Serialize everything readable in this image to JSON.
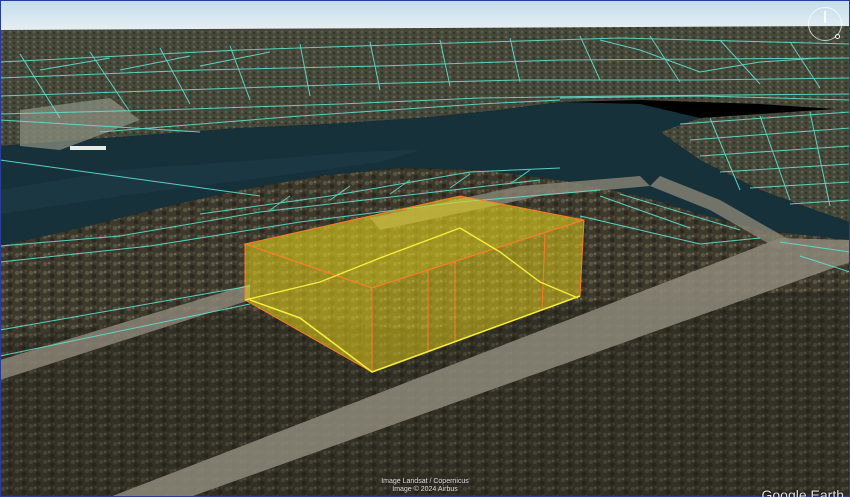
{
  "viewer": {
    "attribution_line1": "Image Landsat / Copernicus",
    "attribution_line2": "Image © 2024 Airbus",
    "logo_text": "Google Earth",
    "colors": {
      "sky": "#cfe3ef",
      "water": "#17313a",
      "parcel_lines": "#5fe0d0",
      "volume_fill": "#e8d21a",
      "volume_edge": "#ff7a2a",
      "volume_base": "#f4ee3a"
    },
    "icons": {
      "compass": "compass-icon"
    }
  }
}
